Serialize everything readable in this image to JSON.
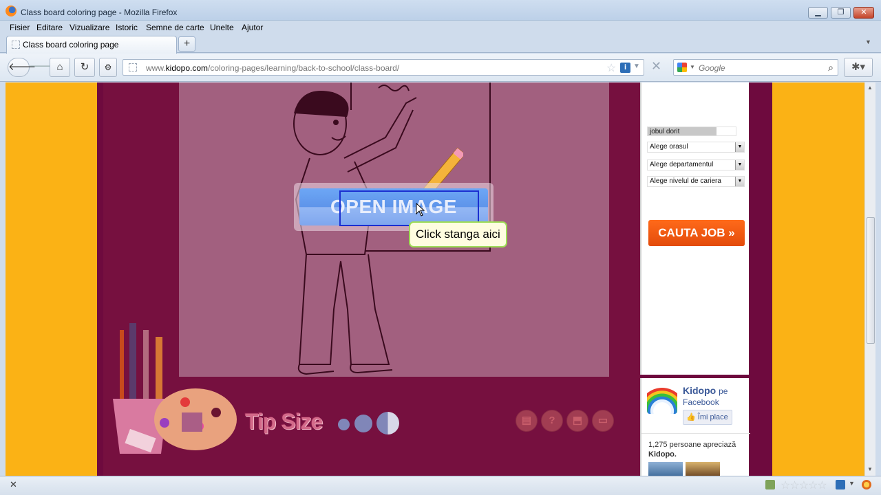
{
  "window": {
    "title": "Class board coloring page - Mozilla Firefox",
    "minimize": "▭",
    "maximize": "❐",
    "close": "✕"
  },
  "menu": [
    "Fisier",
    "Editare",
    "Vizualizare",
    "Istoric",
    "Semne de carte",
    "Unelte",
    "Ajutor"
  ],
  "tab": {
    "label": "Class board coloring page",
    "new_tab": "+"
  },
  "nav": {
    "url_prefix": "www.",
    "url_domain": "kidopo.com",
    "url_path": "/coloring-pages/learning/back-to-school/class-board/",
    "search_placeholder": "Google"
  },
  "canvas": {
    "open_image_label": "OPEN IMAGE",
    "tooltip": "Click stanga aici",
    "tip_size_label": "Tip Size"
  },
  "sidebar": {
    "job_field": "jobul dorit",
    "selects": [
      "Alege orasul",
      "Alege departamentul",
      "Alege nivelul de cariera"
    ],
    "search_button": "CAUTA JOB »"
  },
  "facebook": {
    "page_name": "Kidopo",
    "pe": "pe",
    "network": "Facebook",
    "like_button": "Îmi place",
    "count_text": "1,275 persoane apreciază",
    "count_page": "Kidopo."
  },
  "colors": {
    "page_bg": "#fbb215",
    "maroon": "#6e0a3e",
    "coloring_bg": "#a2607f",
    "open_image_blue": "#6da7f5",
    "cauta_orange": "#ff6a1a",
    "fb_blue": "#3b5998"
  }
}
